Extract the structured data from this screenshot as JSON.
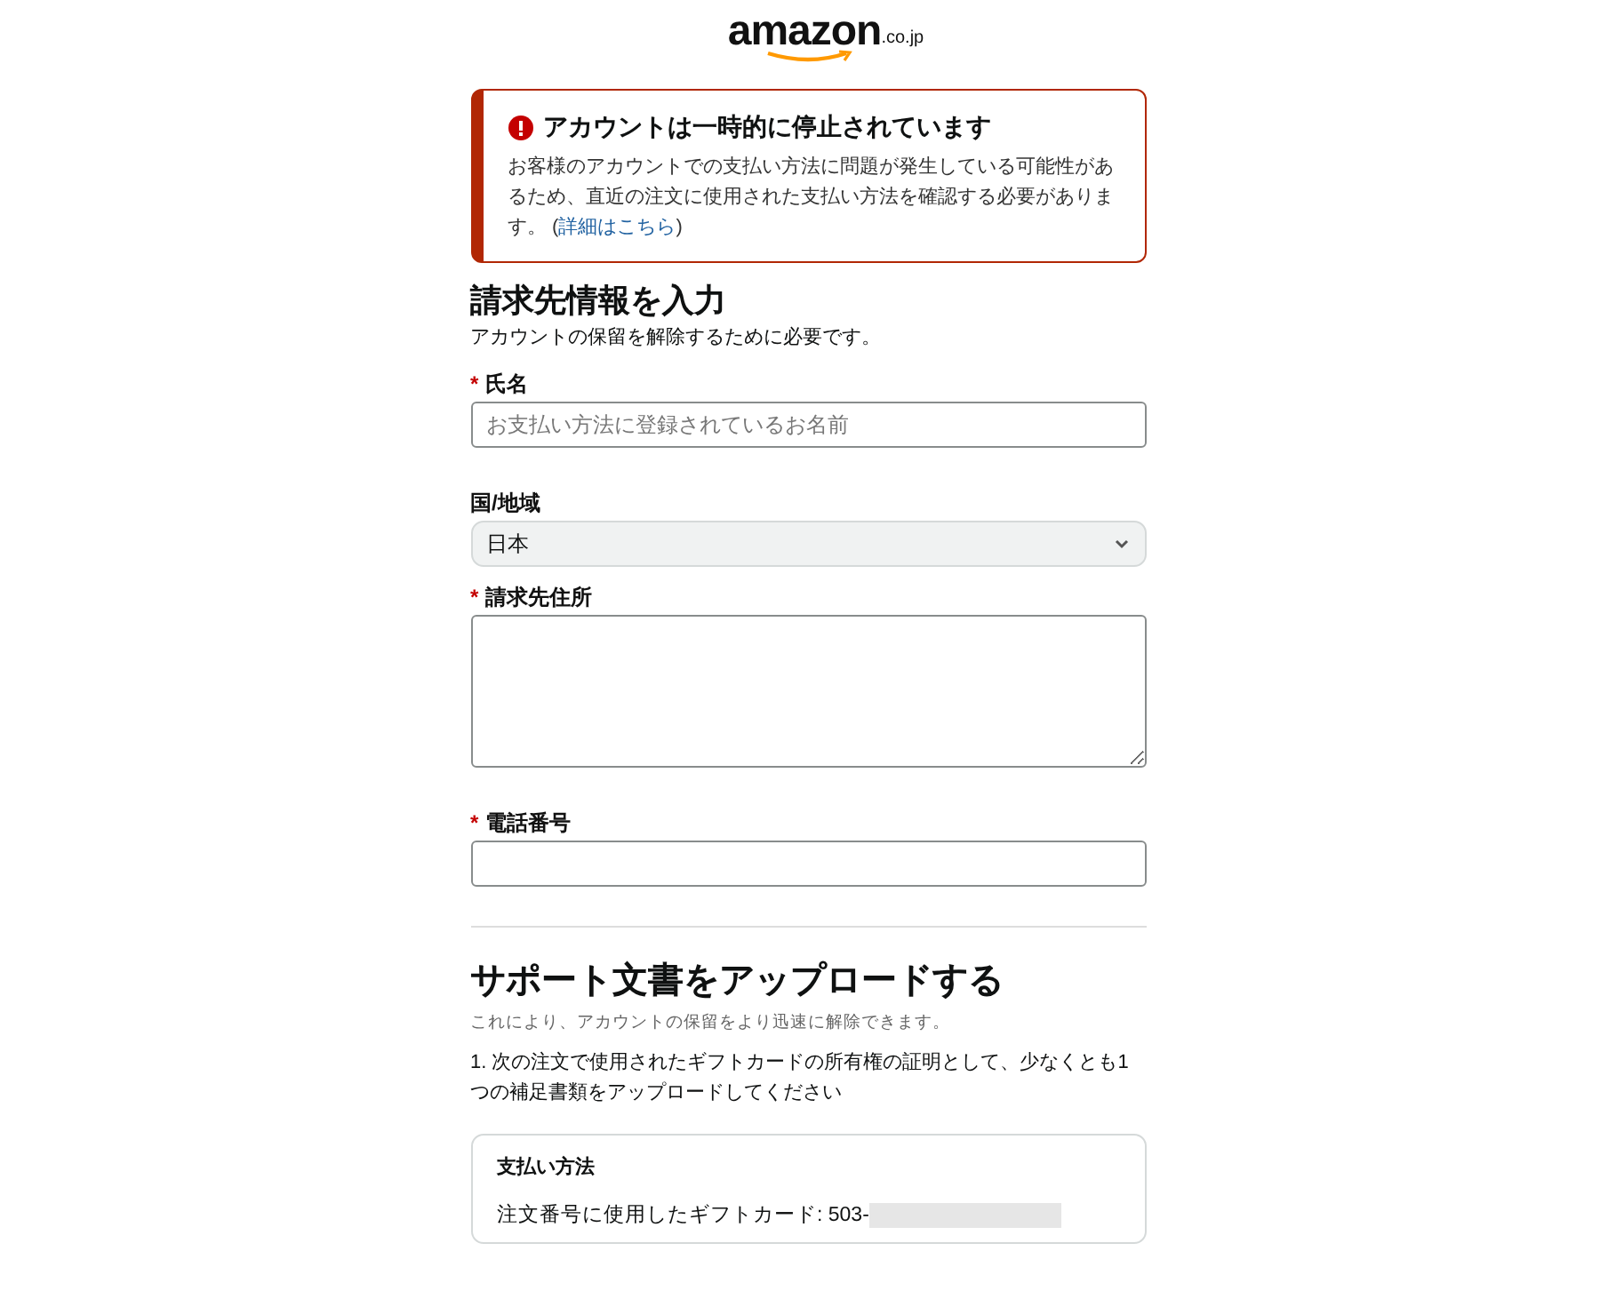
{
  "logo": {
    "wordmark": "amazon",
    "domain": ".co.jp"
  },
  "alert": {
    "title": "アカウントは一時的に停止されています",
    "body": "お客様のアカウントでの支払い方法に問題が発生している可能性があるため、直近の注文に使用された支払い方法を確認する必要があります。 (",
    "link": "詳細はこちら",
    "body_end": ")"
  },
  "billing": {
    "heading": "請求先情報を入力",
    "subtitle": "アカウントの保留を解除するために必要です。",
    "fields": [
      {
        "kind": "text",
        "marker": "*",
        "label": "氏名",
        "placeholder": "お支払い方法に登録されているお名前"
      },
      {
        "kind": "select",
        "label": "国/地域",
        "value": "日本"
      },
      {
        "kind": "textarea",
        "marker": "*",
        "label": "請求先住所"
      },
      {
        "kind": "text",
        "marker": "*",
        "label": "電話番号"
      }
    ]
  },
  "upload": {
    "heading": "サポート文書をアップロードする",
    "subtitle": "これにより、アカウントの保留をより迅速に解除できます。",
    "instruction": "1. 次の注文で使用されたギフトカードの所有権の証明として、少なくとも1つの補足書類をアップロードしてください",
    "card": {
      "title": "支払い方法",
      "line": "注文番号に使用したギフトカード: 503-"
    }
  }
}
